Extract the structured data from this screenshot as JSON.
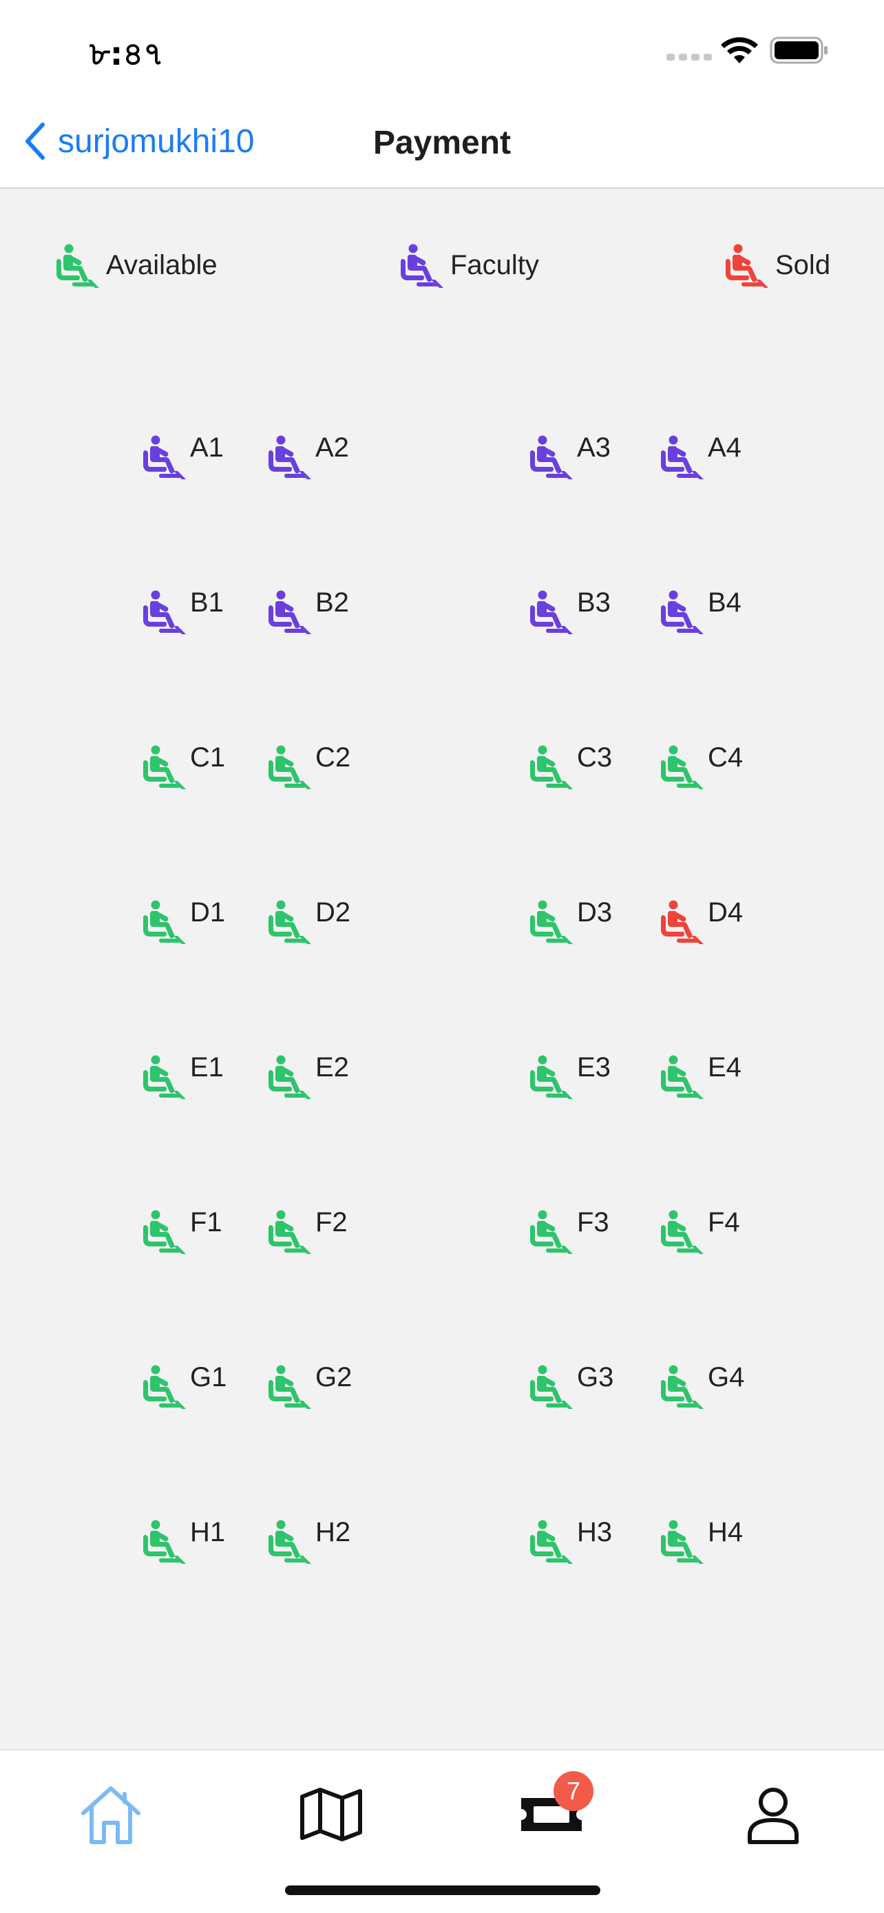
{
  "status_bar": {
    "time": "৮:৪৭"
  },
  "nav": {
    "back_label": "surjomukhi10",
    "title": "Payment"
  },
  "colors": {
    "available": "#2ec46b",
    "faculty": "#6a3fdf",
    "sold": "#f0433a",
    "accent": "#1a7cf5",
    "badge": "#f25a4a"
  },
  "legend": [
    {
      "label": "Available",
      "status": "available"
    },
    {
      "label": "Faculty",
      "status": "faculty"
    },
    {
      "label": "Sold",
      "status": "sold"
    }
  ],
  "seats": [
    [
      {
        "label": "A1",
        "status": "faculty"
      },
      {
        "label": "A2",
        "status": "faculty"
      },
      {
        "label": "A3",
        "status": "faculty"
      },
      {
        "label": "A4",
        "status": "faculty"
      }
    ],
    [
      {
        "label": "B1",
        "status": "faculty"
      },
      {
        "label": "B2",
        "status": "faculty"
      },
      {
        "label": "B3",
        "status": "faculty"
      },
      {
        "label": "B4",
        "status": "faculty"
      }
    ],
    [
      {
        "label": "C1",
        "status": "available"
      },
      {
        "label": "C2",
        "status": "available"
      },
      {
        "label": "C3",
        "status": "available"
      },
      {
        "label": "C4",
        "status": "available"
      }
    ],
    [
      {
        "label": "D1",
        "status": "available"
      },
      {
        "label": "D2",
        "status": "available"
      },
      {
        "label": "D3",
        "status": "available"
      },
      {
        "label": "D4",
        "status": "sold"
      }
    ],
    [
      {
        "label": "E1",
        "status": "available"
      },
      {
        "label": "E2",
        "status": "available"
      },
      {
        "label": "E3",
        "status": "available"
      },
      {
        "label": "E4",
        "status": "available"
      }
    ],
    [
      {
        "label": "F1",
        "status": "available"
      },
      {
        "label": "F2",
        "status": "available"
      },
      {
        "label": "F3",
        "status": "available"
      },
      {
        "label": "F4",
        "status": "available"
      }
    ],
    [
      {
        "label": "G1",
        "status": "available"
      },
      {
        "label": "G2",
        "status": "available"
      },
      {
        "label": "G3",
        "status": "available"
      },
      {
        "label": "G4",
        "status": "available"
      }
    ],
    [
      {
        "label": "H1",
        "status": "available"
      },
      {
        "label": "H2",
        "status": "available"
      },
      {
        "label": "H3",
        "status": "available"
      },
      {
        "label": "H4",
        "status": "available"
      }
    ]
  ],
  "tabs": [
    {
      "icon": "home-icon",
      "active": true
    },
    {
      "icon": "map-icon",
      "active": false
    },
    {
      "icon": "ticket-icon",
      "active": false,
      "badge": "7"
    },
    {
      "icon": "person-icon",
      "active": false
    }
  ]
}
